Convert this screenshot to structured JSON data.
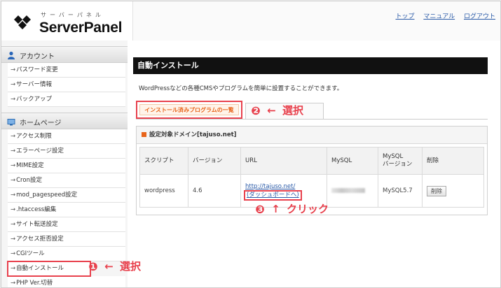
{
  "logo": {
    "kana": "サーバーパネル",
    "name": "ServerPanel"
  },
  "header_links": [
    "トップ",
    "マニュアル",
    "ログアウト"
  ],
  "sidebar": {
    "categories": [
      {
        "label": "アカウント",
        "icon": "account-person-icon",
        "items": [
          "パスワード変更",
          "サーバー情報",
          "バックアップ"
        ]
      },
      {
        "label": "ホームページ",
        "icon": "homepage-icon",
        "items": [
          "アクセス制限",
          "エラーページ設定",
          "MIME設定",
          "Cron設定",
          "mod_pagespeed設定",
          ".htaccess編集",
          "サイト転送設定",
          "アクセス拒否設定",
          "CGIツール",
          "自動インストール",
          "PHP Ver.切替"
        ]
      }
    ],
    "item_prefix": "→"
  },
  "main": {
    "title": "自動インストール",
    "description": "WordPressなどの各種CMSやプログラムを簡単に設置することができます。",
    "tab_active": "インストール済みプログラムの一覧",
    "domain_label": "設定対象ドメイン[tajuso.net]",
    "table": {
      "headers": [
        "スクリプト",
        "バージョン",
        "URL",
        "MySQL",
        "MySQL\nバージョン",
        "削除"
      ],
      "rows": [
        {
          "script": "wordpress",
          "version": "4.6",
          "url": "http://tajuso.net/",
          "dashboard": "(ダッシュボードへ)",
          "mysql_version": "MySQL5.7",
          "delete": "削除"
        }
      ]
    }
  },
  "annotations": [
    {
      "num": "❶",
      "arrow": "←",
      "text": "選択"
    },
    {
      "num": "❷",
      "arrow": "←",
      "text": "選択"
    },
    {
      "num": "❸",
      "arrow": "↑",
      "text": "クリック"
    }
  ],
  "colors": {
    "accent_red": "#e8414d",
    "tab_orange": "#e8641a",
    "link_blue": "#2a5aa8"
  }
}
